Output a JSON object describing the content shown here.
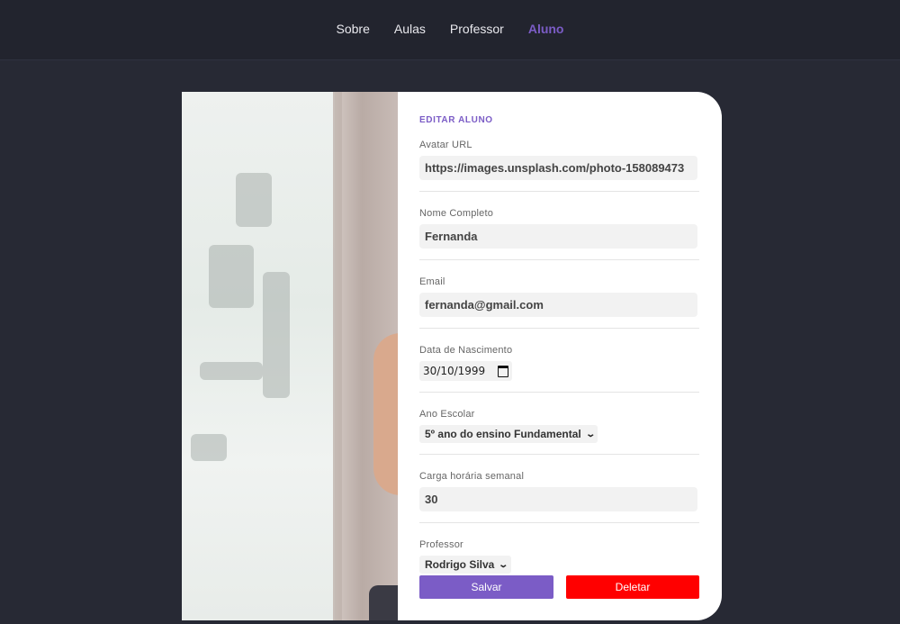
{
  "nav": {
    "items": [
      "Sobre",
      "Aulas",
      "Professor",
      "Aluno"
    ],
    "active": "Aluno"
  },
  "form": {
    "title": "EDITAR ALUNO",
    "avatar": {
      "label": "Avatar URL",
      "value": "https://images.unsplash.com/photo-158089473"
    },
    "name": {
      "label": "Nome Completo",
      "value": "Fernanda"
    },
    "email": {
      "label": "Email",
      "value": "fernanda@gmail.com"
    },
    "birth": {
      "label": "Data de Nascimento",
      "value": "30/10/1999"
    },
    "grade": {
      "label": "Ano Escolar",
      "value": "5º ano do ensino Fundamental"
    },
    "hours": {
      "label": "Carga horária semanal",
      "value": "30"
    },
    "teacher": {
      "label": "Professor",
      "value": "Rodrigo Silva"
    }
  },
  "buttons": {
    "save": "Salvar",
    "delete": "Deletar"
  },
  "colors": {
    "accent": "#7b5cc6",
    "danger": "#ff0000",
    "background": "#272934"
  }
}
